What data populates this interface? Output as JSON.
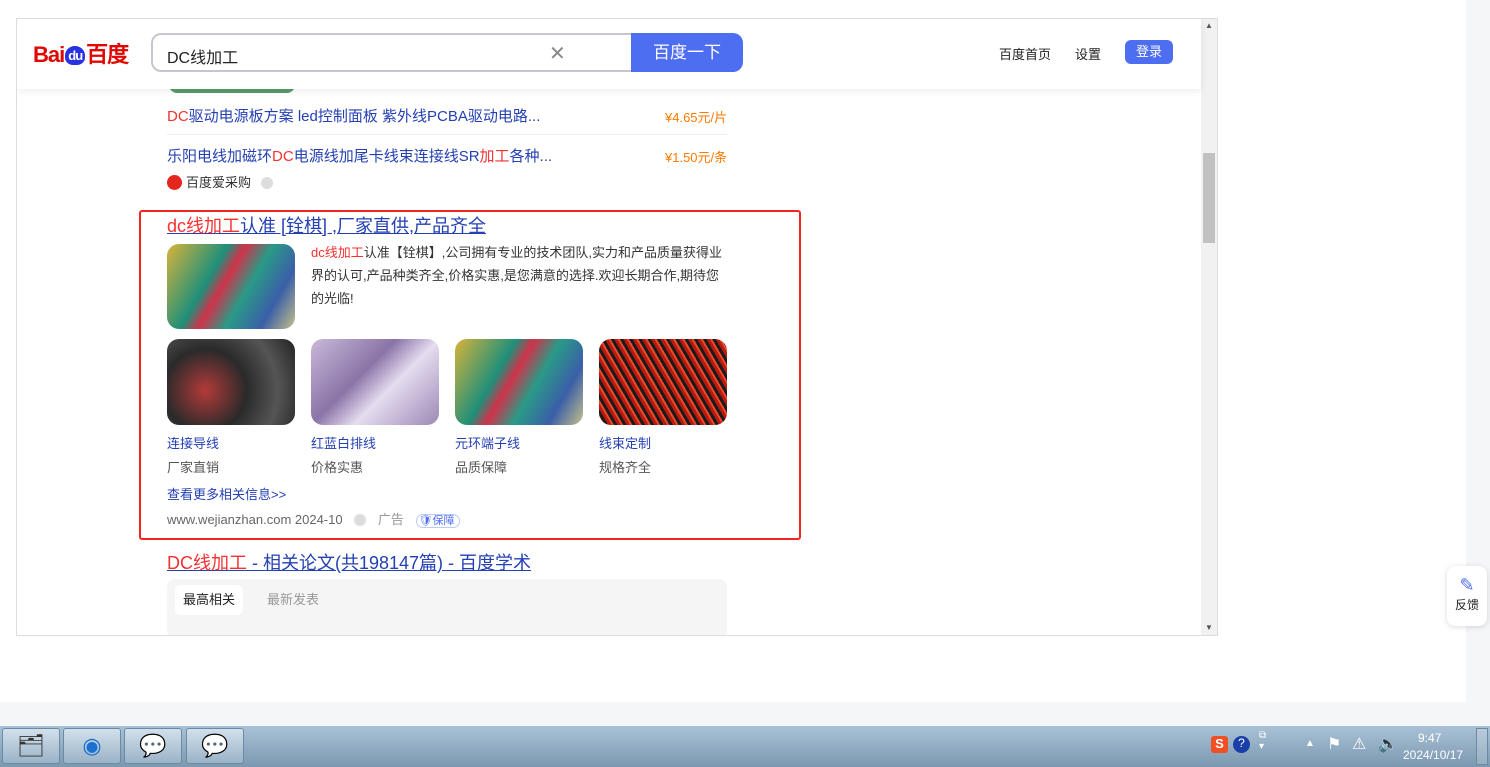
{
  "header": {
    "logo": "Bai du 百度",
    "query": "DC线加工",
    "search_button": "百度一下",
    "nav": [
      "百度首页",
      "设置"
    ],
    "login": "登录"
  },
  "products": [
    {
      "hl": "DC",
      "title": "驱动电源板方案 led控制面板 紫外线PCBA驱动电路...",
      "price": "¥4.65元/片"
    },
    {
      "pre": "乐阳电线加磁环",
      "hl": "DC",
      "mid": "电源线加尾卡线束连接线SR",
      "hl2": "加工",
      "post": "各种...",
      "price": "¥1.50元/条"
    }
  ],
  "source": "百度爱采购",
  "ad": {
    "title_hl": "dc线加工",
    "title_rest": "认准 [铨棋] ,厂家直供,产品齐全",
    "desc_hl": "dc线加工",
    "desc": "认准【铨棋】,公司拥有专业的技术团队,实力和产品质量获得业界的认可,产品种类齐全,价格实惠,是您满意的选择.欢迎长期合作,期待您的光临!",
    "items": [
      {
        "title": "连接导线",
        "sub": "厂家直销"
      },
      {
        "title": "红蓝白排线",
        "sub": "价格实惠"
      },
      {
        "title": "元环端子线",
        "sub": "品质保障"
      },
      {
        "title": "线束定制",
        "sub": "规格齐全"
      }
    ],
    "more": "查看更多相关信息>>",
    "url": "www.wejianzhan.com 2024-10",
    "ad_label": "广告",
    "badge": "保障"
  },
  "scholar": {
    "title_hl": "DC线加工",
    "title_rest": " - 相关论文(共198147篇) - 百度学术",
    "tabs": [
      "最高相关",
      "最新发表"
    ]
  },
  "feedback": "反馈",
  "taskbar": {
    "time": "9:47",
    "date": "2024/10/17"
  },
  "colors": {
    "accent": "#4e6ef2",
    "highlight": "#f73131",
    "link": "#2440b3",
    "box": "#f0261f"
  }
}
